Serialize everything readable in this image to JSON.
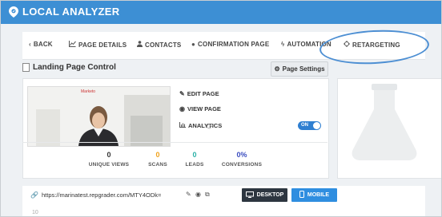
{
  "app": {
    "title": "LOCAL ANALYZER"
  },
  "nav": {
    "back": "BACK",
    "page_details": "PAGE DETAILS",
    "contacts": "CONTACTS",
    "confirmation_page": "CONFIRMATION PAGE",
    "automation": "AUTOMATION",
    "retargeting": "RETARGETING"
  },
  "panel": {
    "title": "Landing Page Control",
    "settings_label": "Page Settings"
  },
  "preview": {
    "brand": "Marketo"
  },
  "actions": {
    "edit": "EDIT PAGE",
    "view": "VIEW PAGE",
    "analytics": "ANALYTICS",
    "toggle": "ON"
  },
  "stats": [
    {
      "value": "0",
      "label": "UNIQUE VIEWS",
      "color": "#333333"
    },
    {
      "value": "0",
      "label": "SCANS",
      "color": "#f0a21c"
    },
    {
      "value": "0",
      "label": "LEADS",
      "color": "#2ab0a6"
    },
    {
      "value": "0%",
      "label": "CONVERSIONS",
      "color": "#3a4cbf"
    }
  ],
  "url": {
    "text": "https://marinatest.repgrader.com/MTY4ODk=",
    "desktop": "DESKTOP",
    "mobile": "MOBILE"
  },
  "editor": {
    "line_number": "10"
  },
  "colors": {
    "brand_blue": "#3d8fd4",
    "toggle_blue": "#2f7fd1",
    "dark_button": "#2d3640"
  }
}
